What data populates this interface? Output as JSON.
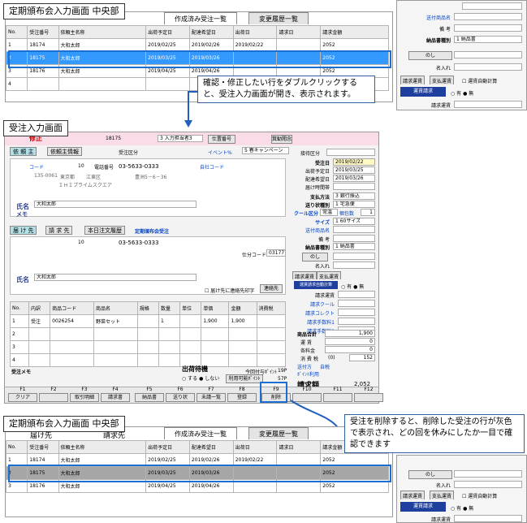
{
  "callouts": {
    "top_title": "定期頒布会入力画面 中央部",
    "mid_title": "受注入力画面",
    "bottom_title": "定期頒布会入力画面 中央部",
    "dbl_click_note": "確認・修正したい行をダブルクリックすると、受注入力画面が開き、表示されます。",
    "delete_note": "受注を削除すると、削除した受注の行が灰色で表示され、どの回を休みにしたか一目で確認できます"
  },
  "tabs": {
    "created": "作成済み受注一覧",
    "history": "変更履歴一覧",
    "shipping": "届け先",
    "billing": "請求先"
  },
  "grid": {
    "headers": [
      "No.",
      "受注番号",
      "依頼主名称",
      "出荷予定日",
      "配達希望日",
      "出荷日",
      "請求日",
      "請求金額"
    ],
    "rows_top": [
      {
        "no": "1",
        "order": "18174",
        "name": "大和太郎",
        "ship": "2019/02/25",
        "deliver": "2019/02/26",
        "shipped": "2019/02/22",
        "bill": "",
        "amount": "2052"
      },
      {
        "no": "2",
        "order": "18175",
        "name": "大和太郎",
        "ship": "2019/03/25",
        "deliver": "2019/03/26",
        "shipped": "",
        "bill": "",
        "amount": "2052"
      },
      {
        "no": "3",
        "order": "18176",
        "name": "大和太郎",
        "ship": "2019/04/25",
        "deliver": "2019/04/26",
        "shipped": "",
        "bill": "",
        "amount": "2052"
      },
      {
        "no": "4",
        "order": "",
        "name": "",
        "ship": "",
        "deliver": "",
        "shipped": "",
        "bill": "",
        "amount": ""
      }
    ],
    "rows_bottom": [
      {
        "no": "1",
        "order": "18174",
        "name": "大和太郎",
        "ship": "2019/02/25",
        "deliver": "2019/02/26",
        "shipped": "2019/02/22",
        "bill": "",
        "amount": "2052"
      },
      {
        "no": "2",
        "order": "18175",
        "name": "大和太郎",
        "ship": "2019/03/25",
        "deliver": "2019/03/26",
        "shipped": "",
        "bill": "",
        "amount": "2052"
      },
      {
        "no": "3",
        "order": "18176",
        "name": "大和太郎",
        "ship": "2019/04/25",
        "deliver": "2019/04/26",
        "shipped": "",
        "bill": "",
        "amount": "2052"
      }
    ]
  },
  "right_panel": {
    "ship_product_name": "送付商品名",
    "memo": "備 考",
    "delivery_doc": "納品書種別",
    "delivery_doc_val": "1 納品書",
    "noshi": "のし",
    "recipient": "名入れ",
    "tab_ship_fee": "請求運賃",
    "tab_pay_fee": "支払運賃",
    "auto_calc": "運賃自動計算",
    "billing_fee_btn": "運賃請求",
    "yes": "有",
    "no": "無",
    "billing_fee": "請求運賃"
  },
  "order_form": {
    "header_red": "修正",
    "order_no": "18175",
    "kind": "3 入力担当者3",
    "customer_no": "仕置番号",
    "company": "箕勧閲念",
    "client_tab": "依 頼 主",
    "client_info_tab": "依頼主情報",
    "flag": "受注区分",
    "event": "イベント%",
    "event_val": "5 春キャンペーン",
    "kana": "コード",
    "code": "10",
    "tel_label": "電話番号",
    "tel": "03-5633-0333",
    "own_code": "自社コード",
    "zip": "135-0061",
    "pref": "東京都",
    "ward": "江東区",
    "addr": "豊洲5－6－36",
    "bldg": "ＩＨＩプライムスクエア",
    "name_label": "氏名",
    "name": "大和太郎",
    "memo_label": "メモ",
    "dest_tab": "届 け 先",
    "bill_tab": "請 求 先",
    "main_bill": "本日注文履歴",
    "sub_note": "定期頒布会受注",
    "dest_code": "10",
    "dest_tel": "03-5633-0333",
    "branch_code": "仕分コード",
    "branch_val": "0317777",
    "note_chk": "届け先に連絡先印字",
    "contact_btn": "連絡先",
    "items_headers": [
      "No.",
      "内訳",
      "商品コード",
      "商品名",
      "規格",
      "数量",
      "単位",
      "単価",
      "金額",
      "消費税"
    ],
    "item_row": {
      "no": "1",
      "kind": "受注",
      "code": "0026254",
      "name": "野菜セット",
      "qty": "1",
      "price": "1,900",
      "amount": "1,900"
    },
    "order_memo": "受注メモ",
    "hold_label": "出荷待機",
    "hold_yes": "する",
    "hold_no": "しない",
    "today_point": "今回付与ﾎﾟｲﾝﾄ",
    "today_point_val": "19P",
    "used_point": "利用可能ﾎﾟｲﾝﾄ",
    "used_point_val": "57P",
    "side": {
      "category": "接待区分",
      "order_date": "受注日",
      "order_date_val": "2019/02/22",
      "ship_date": "出荷予定日",
      "ship_date_val": "2019/03/25",
      "deliver_date": "配達希望日",
      "deliver_date_val": "2019/03/26",
      "deliver_time": "届け時間帯",
      "pay_method": "支払方法",
      "pay_method_val": "3 銀行振込",
      "carrier": "送り状種別",
      "carrier_val": "1 宅急便",
      "cool": "クール区分",
      "cool_val": "常温",
      "pack": "梱包数",
      "pack_val": "1",
      "size": "サイズ",
      "size_val": "1 60サイズ",
      "product_name": "送付商品名",
      "memo": "備 考",
      "doc": "納品書種別",
      "doc_val": "1 納品書",
      "noshi": "のし",
      "name_in": "名入れ",
      "fee_tab1": "請求運賃",
      "fee_tab2": "支払運賃",
      "auto": "運賃請求自動計算",
      "yes": "有",
      "no": "無",
      "f_billing": "請求運賃",
      "f_cool": "請求クール",
      "f_collect": "請求コレクト",
      "f_fee1": "請求手数料1",
      "f_fee2": "請求手数料2",
      "subtotal": "商品合計",
      "subtotal_val": "1,900",
      "shipping": "運 賃",
      "shipping_val": "0",
      "fee": "各料金",
      "fee_val": "0",
      "tax": "消 費 税",
      "tax_val": "152",
      "tax_paren": "(0)",
      "tax_type": "送付方",
      "tax_type_val": "自税",
      "point_use": "ﾎﾟｲﾝﾄ利用",
      "total_label": "請求額",
      "total_val": "2,052"
    }
  },
  "fkeys": [
    {
      "key": "F1",
      "label": "クリア"
    },
    {
      "key": "F2",
      "label": ""
    },
    {
      "key": "F3",
      "label": "取引明細"
    },
    {
      "key": "F4",
      "label": "請求書"
    },
    {
      "key": "F5",
      "label": "納品書"
    },
    {
      "key": "F6",
      "label": "送り状"
    },
    {
      "key": "F7",
      "label": "未請一覧"
    },
    {
      "key": "F8",
      "label": "登録"
    },
    {
      "key": "F9",
      "label": "削除"
    },
    {
      "key": "F10",
      "label": ""
    },
    {
      "key": "F11",
      "label": ""
    },
    {
      "key": "F12",
      "label": ""
    }
  ]
}
